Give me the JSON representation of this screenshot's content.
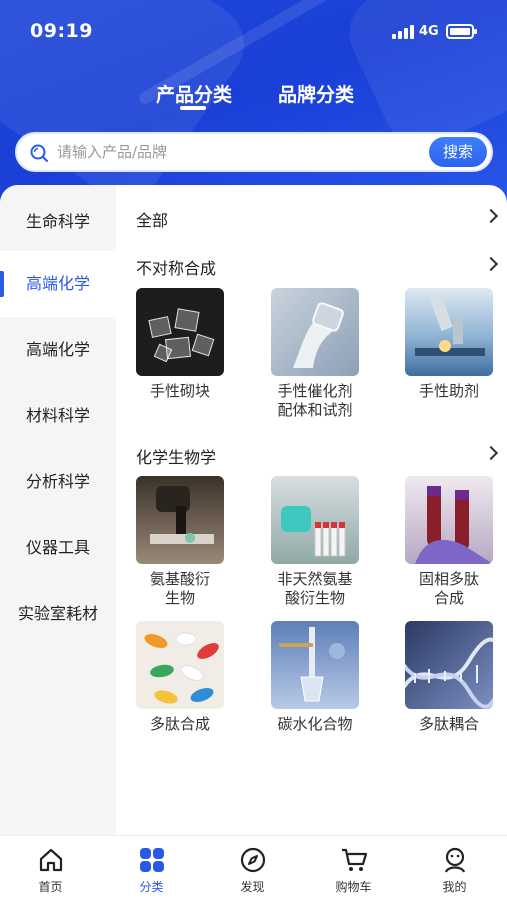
{
  "status_bar": {
    "time": "09:19",
    "network": "4G"
  },
  "tabs": [
    {
      "label": "产品分类",
      "active": true
    },
    {
      "label": "品牌分类",
      "active": false
    }
  ],
  "search": {
    "placeholder": "请输入产品/品牌",
    "button_label": "搜索"
  },
  "sidebar": {
    "items": [
      {
        "label": "生命科学",
        "active": false
      },
      {
        "label": "高端化学",
        "active": true
      },
      {
        "label": "高端化学",
        "active": false
      },
      {
        "label": "材料科学",
        "active": false
      },
      {
        "label": "分析科学",
        "active": false
      },
      {
        "label": "仪器工具",
        "active": false
      },
      {
        "label": "实验室耗材",
        "active": false
      }
    ]
  },
  "main": {
    "all_label": "全部",
    "sections": [
      {
        "title": "不对称合成",
        "items": [
          {
            "label": "手性砌块",
            "icon": "chiral-blocks-image"
          },
          {
            "label": "手性催化剂\n配体和试剂",
            "icon": "catalyst-image"
          },
          {
            "label": "手性助剂",
            "icon": "microscope-image"
          }
        ]
      },
      {
        "title": "化学生物学",
        "items": [
          {
            "label": "氨基酸衍\n生物",
            "icon": "microscope-dark-image"
          },
          {
            "label": "非天然氨基\n酸衍生物",
            "icon": "test-tubes-image"
          },
          {
            "label": "固相多肽\n合成",
            "icon": "blood-tubes-image"
          },
          {
            "label": "多肽合成",
            "icon": "capsules-image"
          },
          {
            "label": "碳水化合物",
            "icon": "lab-apparatus-image"
          },
          {
            "label": "多肽耦合",
            "icon": "dna-helix-image"
          }
        ]
      }
    ]
  },
  "bottom_nav": [
    {
      "label": "首页",
      "icon": "home-icon",
      "active": false
    },
    {
      "label": "分类",
      "icon": "category-icon",
      "active": true
    },
    {
      "label": "发现",
      "icon": "compass-icon",
      "active": false
    },
    {
      "label": "购物车",
      "icon": "cart-icon",
      "active": false
    },
    {
      "label": "我的",
      "icon": "profile-icon",
      "active": false
    }
  ],
  "colors": {
    "brand": "#2b58e8",
    "header_bg": "#1f47d8",
    "sidebar_bg": "#f5f5f7"
  }
}
